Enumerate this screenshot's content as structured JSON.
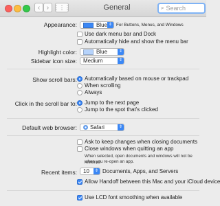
{
  "window": {
    "title": "General"
  },
  "search": {
    "placeholder": "Search"
  },
  "appearance": {
    "label": "Appearance:",
    "value": "Blue",
    "swatch_color": "#3b87f5",
    "hint": "For Buttons, Menus, and Windows",
    "dark_menu": "Use dark menu bar and Dock",
    "auto_hide": "Automatically hide and show the menu bar"
  },
  "highlight": {
    "label": "Highlight color:",
    "value": "Blue",
    "swatch_color": "#b6d3fb"
  },
  "sidebar": {
    "label": "Sidebar icon size:",
    "value": "Medium"
  },
  "scrollbars": {
    "label": "Show scroll bars:",
    "options": [
      "Automatically based on mouse or trackpad",
      "When scrolling",
      "Always"
    ],
    "selected": 0
  },
  "click": {
    "label": "Click in the scroll bar to:",
    "options": [
      "Jump to the next page",
      "Jump to the spot that's clicked"
    ],
    "selected": 0
  },
  "browser": {
    "label": "Default web browser:",
    "value": "Safari"
  },
  "documents": {
    "ask_keep": "Ask to keep changes when closing documents",
    "close_windows": "Close windows when quitting an app",
    "note_line1": "When selected, open documents and windows will not be restored",
    "note_line2": "when you re-open an app."
  },
  "recent": {
    "label": "Recent items:",
    "value": "10",
    "suffix": "Documents, Apps, and Servers"
  },
  "handoff": {
    "label": "Allow Handoff between this Mac and your iCloud devices"
  },
  "lcd": {
    "label": "Use LCD font smoothing when available"
  }
}
